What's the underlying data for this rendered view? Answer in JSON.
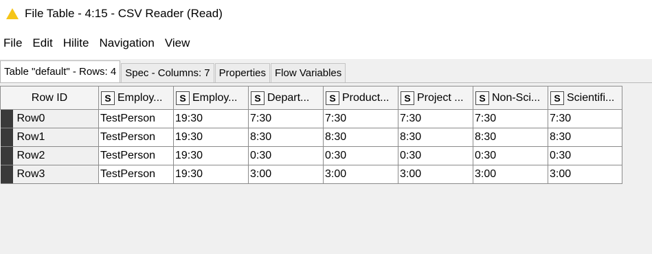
{
  "window": {
    "title": "File Table - 4:15 - CSV Reader (Read)",
    "icon": "knime-triangle-icon",
    "icon_color": "#f5c518"
  },
  "menu": {
    "items": [
      "File",
      "Edit",
      "Hilite",
      "Navigation",
      "View"
    ]
  },
  "tabs": [
    {
      "label": "Table \"default\" - Rows: 4",
      "active": true
    },
    {
      "label": "Spec - Columns: 7",
      "active": false
    },
    {
      "label": "Properties",
      "active": false
    },
    {
      "label": "Flow Variables",
      "active": false
    }
  ],
  "table": {
    "rowid_header": "Row ID",
    "type_badge": "S",
    "columns": [
      "Employ...",
      "Employ...",
      "Depart...",
      "Product...",
      "Project ...",
      "Non-Sci...",
      "Scientifi..."
    ],
    "rows": [
      {
        "id": "Row0",
        "cells": [
          "TestPerson",
          "19:30",
          "7:30",
          "7:30",
          "7:30",
          "7:30",
          "7:30"
        ]
      },
      {
        "id": "Row1",
        "cells": [
          "TestPerson",
          "19:30",
          "8:30",
          "8:30",
          "8:30",
          "8:30",
          "8:30"
        ]
      },
      {
        "id": "Row2",
        "cells": [
          "TestPerson",
          "19:30",
          "0:30",
          "0:30",
          "0:30",
          "0:30",
          "0:30"
        ]
      },
      {
        "id": "Row3",
        "cells": [
          "TestPerson",
          "19:30",
          "3:00",
          "3:00",
          "3:00",
          "3:00",
          "3:00"
        ]
      }
    ]
  }
}
